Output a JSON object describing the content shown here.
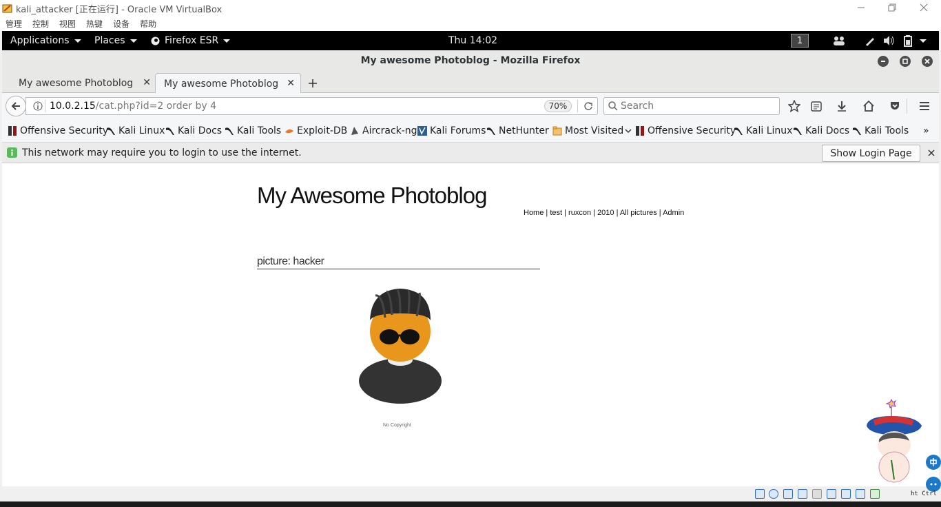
{
  "virtualbox": {
    "title": "kali_attacker [正在运行] - Oracle VM VirtualBox",
    "menu": [
      "管理",
      "控制",
      "视图",
      "热键",
      "设备",
      "帮助"
    ]
  },
  "gnome_panel": {
    "applications": "Applications",
    "places": "Places",
    "firefox": "Firefox ESR",
    "clock": "Thu 14:02",
    "workspace": "1"
  },
  "firefox": {
    "window_title": "My awesome Photoblog - Mozilla Firefox",
    "tabs": [
      {
        "label": "My awesome Photoblog",
        "active": false
      },
      {
        "label": "My awesome Photoblog",
        "active": true
      }
    ],
    "url_host": "10.0.2.15",
    "url_path": "/cat.php?id=2 order by 4",
    "zoom": "70%",
    "search_placeholder": "Search",
    "bookmarks": [
      "Offensive Security",
      "Kali Linux",
      "Kali Docs",
      "Kali Tools",
      "Exploit-DB",
      "Aircrack-ng",
      "Kali Forums",
      "NetHunter",
      "Most Visited",
      "Offensive Security",
      "Kali Linux",
      "Kali Docs",
      "Kali Tools"
    ],
    "notification": "This network may require you to login to use the internet.",
    "login_button": "Show Login Page"
  },
  "page": {
    "title": "My Awesome Photoblog",
    "nav": [
      "Home",
      "test",
      "ruxcon",
      "2010",
      "All pictures",
      "Admin"
    ],
    "picture_heading": "picture: hacker",
    "copyright": "No Copyright"
  },
  "overlay": {
    "corner_text": "ht Ctrl"
  }
}
